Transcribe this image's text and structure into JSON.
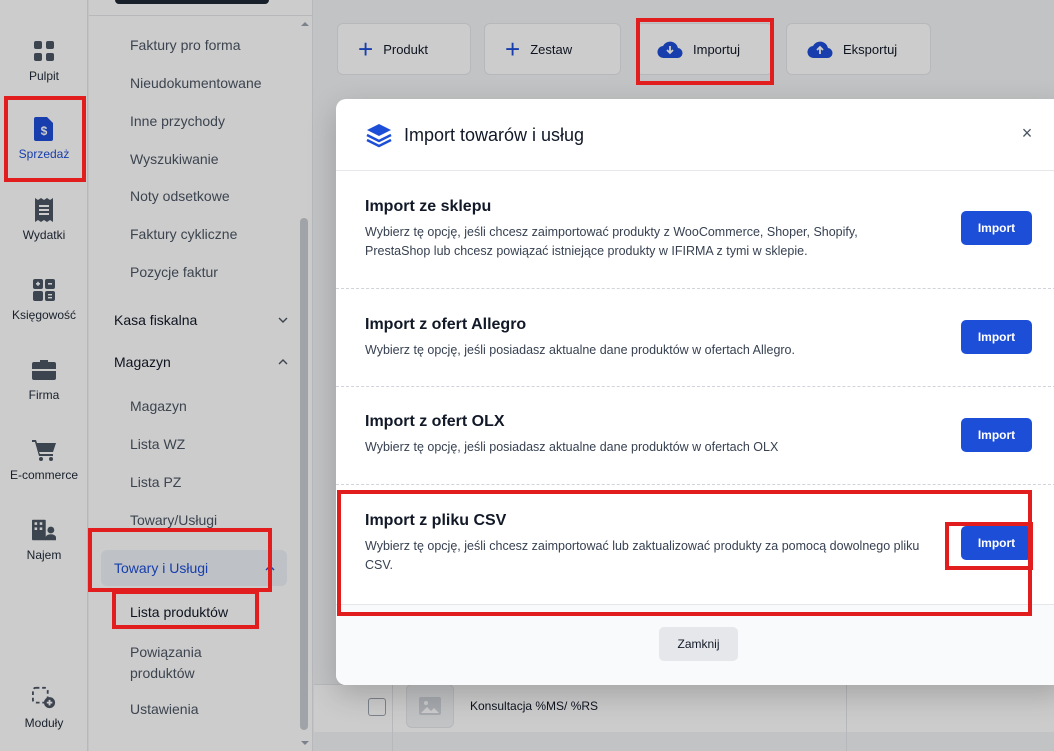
{
  "rail": {
    "items": [
      {
        "label": "Pulpit",
        "icon": "grid-icon"
      },
      {
        "label": "Sprzedaż",
        "icon": "invoice-dollar-icon"
      },
      {
        "label": "Wydatki",
        "icon": "receipt-icon"
      },
      {
        "label": "Księgowość",
        "icon": "calculator-icon"
      },
      {
        "label": "Firma",
        "icon": "briefcase-icon"
      },
      {
        "label": "E-commerce",
        "icon": "cart-icon"
      },
      {
        "label": "Najem",
        "icon": "building-user-icon"
      },
      {
        "label": "Moduły",
        "icon": "modules-add-icon"
      }
    ]
  },
  "submenu": {
    "items_top": [
      "Faktury pro forma",
      "Nieudokumentowane",
      "Inne przychody",
      "Wyszukiwanie",
      "Noty odsetkowe",
      "Faktury cykliczne",
      "Pozycje faktur"
    ],
    "kasa": "Kasa fiskalna",
    "magazyn": "Magazyn",
    "magazyn_items": [
      "Magazyn",
      "Lista WZ",
      "Lista PZ",
      "Towary/Usługi"
    ],
    "towary_group": "Towary i Usługi",
    "towary_items": [
      "Lista produktów",
      "Powiązania produktów",
      "Ustawienia"
    ]
  },
  "toolbar": {
    "produkt": "Produkt",
    "zestaw": "Zestaw",
    "importuj": "Importuj",
    "eksportuj": "Eksportuj"
  },
  "table": {
    "row_text": "Konsultacja %MS/ %RS"
  },
  "modal": {
    "title": "Import towarów i usług",
    "close_icon": "×",
    "options": [
      {
        "title": "Import ze sklepu",
        "desc": "Wybierz tę opcję, jeśli chcesz zaimportować produkty z WooCommerce, Shoper, Shopify, PrestaShop lub chcesz powiązać istniejące produkty w IFIRMA z tymi w sklepie.",
        "button": "Import"
      },
      {
        "title": "Import z ofert Allegro",
        "desc": "Wybierz tę opcję, jeśli posiadasz aktualne dane produktów w ofertach Allegro.",
        "button": "Import"
      },
      {
        "title": "Import z ofert OLX",
        "desc": "Wybierz tę opcję, jeśli posiadasz aktualne dane produktów w ofertach OLX",
        "button": "Import"
      },
      {
        "title": "Import z pliku CSV",
        "desc": "Wybierz tę opcję, jeśli chcesz zaimportować lub zaktualizować produkty za pomocą dowolnego pliku CSV.",
        "button": "Import"
      }
    ],
    "close_label": "Zamknij"
  },
  "colors": {
    "accent": "#1d4ed8",
    "highlight": "#e11d1d"
  }
}
